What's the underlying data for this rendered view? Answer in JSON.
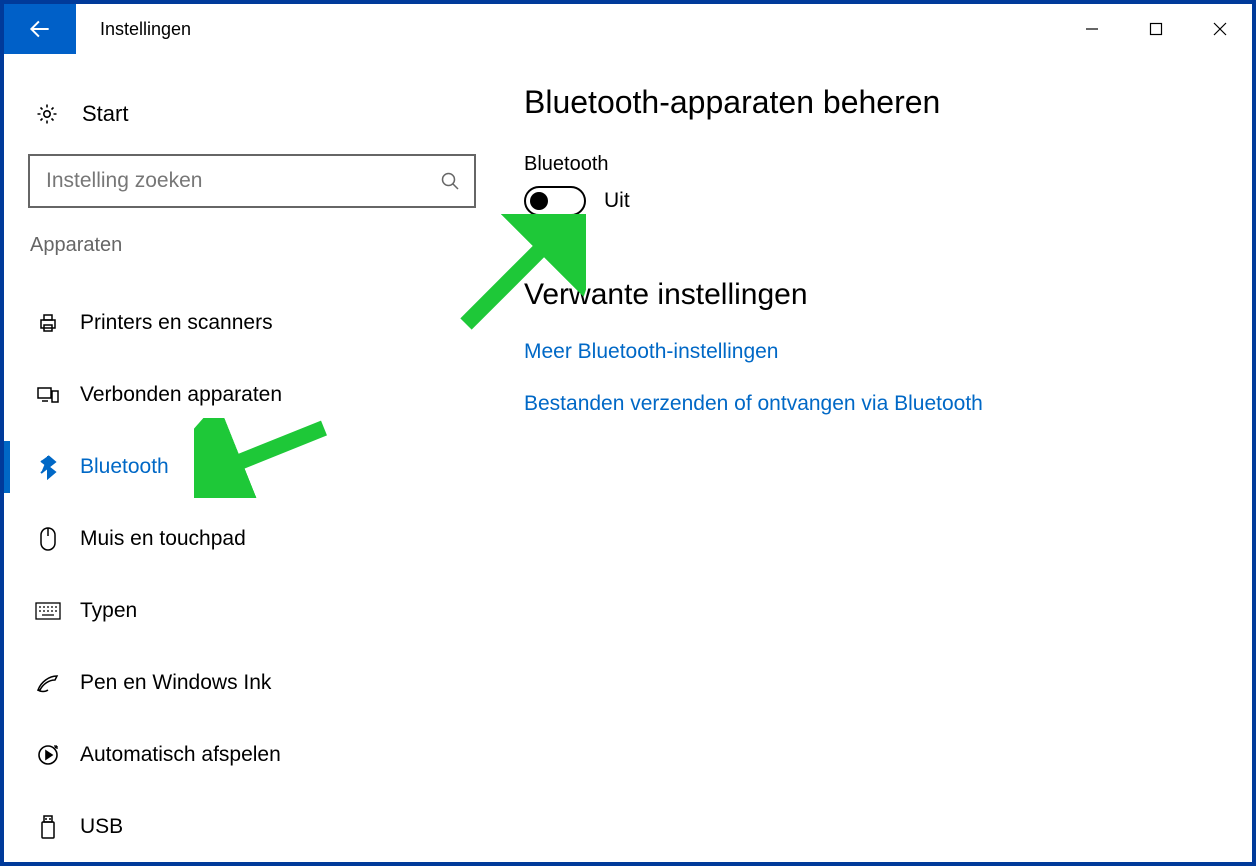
{
  "window": {
    "title": "Instellingen"
  },
  "sidebar": {
    "start_label": "Start",
    "search_placeholder": "Instelling zoeken",
    "section_label": "Apparaten",
    "items": [
      {
        "label": "Printers en scanners",
        "icon": "printer"
      },
      {
        "label": "Verbonden apparaten",
        "icon": "devices"
      },
      {
        "label": "Bluetooth",
        "icon": "bluetooth",
        "active": true
      },
      {
        "label": "Muis en touchpad",
        "icon": "mouse"
      },
      {
        "label": "Typen",
        "icon": "keyboard"
      },
      {
        "label": "Pen en Windows Ink",
        "icon": "pen"
      },
      {
        "label": "Automatisch afspelen",
        "icon": "autoplay"
      },
      {
        "label": "USB",
        "icon": "usb"
      }
    ]
  },
  "main": {
    "title": "Bluetooth-apparaten beheren",
    "toggle_label": "Bluetooth",
    "toggle_state_label": "Uit",
    "toggle_on": false,
    "related_heading": "Verwante instellingen",
    "links": [
      "Meer Bluetooth-instellingen",
      "Bestanden verzenden of ontvangen via Bluetooth"
    ]
  },
  "colors": {
    "accent": "#0068c6",
    "titlebar_back": "#0060c8",
    "arrow": "#1ec838"
  }
}
